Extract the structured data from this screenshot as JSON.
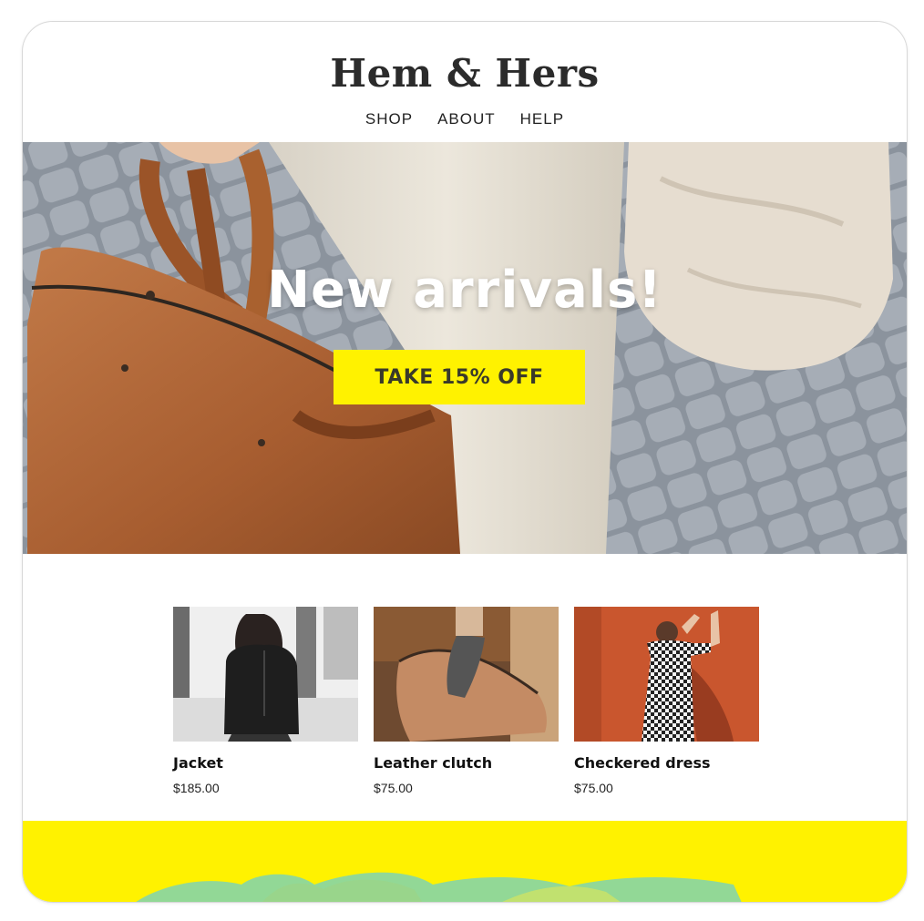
{
  "brand": {
    "name": "Hem & Hers"
  },
  "nav": {
    "items": [
      {
        "label": "SHOP"
      },
      {
        "label": "ABOUT"
      },
      {
        "label": "HELP"
      }
    ]
  },
  "hero": {
    "title": "New arrivals!",
    "cta_label": "TAKE 15% OFF"
  },
  "products": [
    {
      "name": "Jacket",
      "price": "$185.00"
    },
    {
      "name": "Leather clutch",
      "price": "$75.00"
    },
    {
      "name": "Checkered dress",
      "price": "$75.00"
    }
  ],
  "colors": {
    "accent": "#fff200",
    "text": "#2b2b2b",
    "bag": "#b56a3c"
  }
}
